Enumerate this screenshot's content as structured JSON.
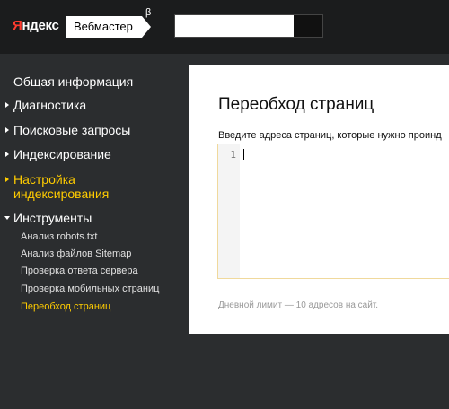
{
  "header": {
    "logo_ya": "Я",
    "logo_rest": "ндекс",
    "service_name": "Вебмастер",
    "beta_mark": "β"
  },
  "sidebar": {
    "items": [
      {
        "label": "Общая информация"
      },
      {
        "label": "Диагностика"
      },
      {
        "label": "Поисковые запросы"
      },
      {
        "label": "Индексирование"
      },
      {
        "label": "Настройка индексирования",
        "line1": "Настройка",
        "line2": "индексирования"
      },
      {
        "label": "Инструменты"
      }
    ],
    "subitems": [
      {
        "label": "Анализ robots.txt"
      },
      {
        "label": "Анализ файлов Sitemap"
      },
      {
        "label": "Проверка ответа сервера"
      },
      {
        "label": "Проверка мобильных страниц"
      },
      {
        "label": "Переобход страниц"
      }
    ]
  },
  "main": {
    "title": "Переобход страниц",
    "field_label": "Введите адреса страниц, которые нужно проинд",
    "editor_line_number": "1",
    "hint": "Дневной лимит — 10 адресов на сайт."
  },
  "colors": {
    "active": "#ffcc00",
    "sidebar_bg": "#2b2d2f",
    "topbar_bg": "#1b1c1d",
    "logo_red": "#ff3b2f"
  },
  "icons": {
    "collapsed": "triangle-right-icon",
    "expanded": "triangle-down-icon"
  }
}
